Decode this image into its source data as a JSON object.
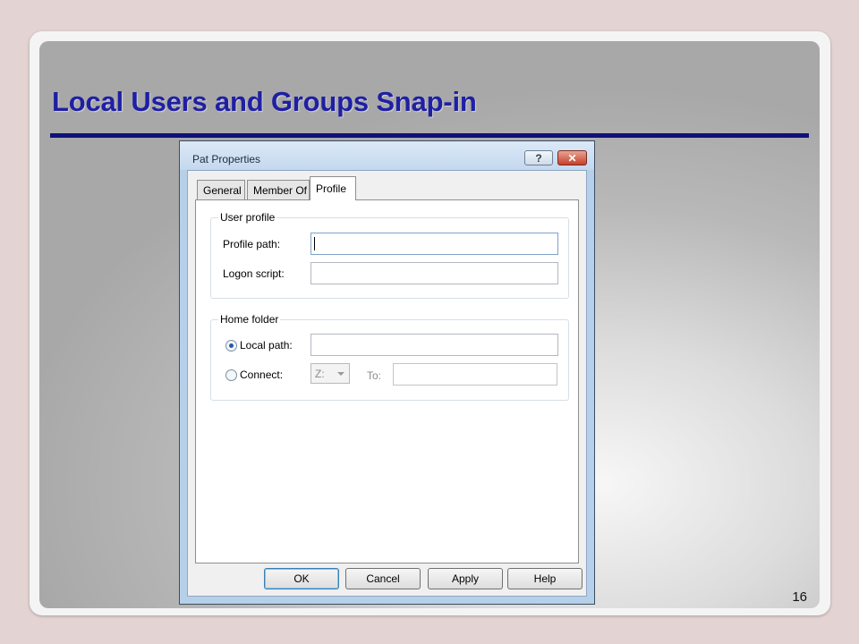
{
  "slide": {
    "title": "Local Users and Groups Snap-in",
    "page_number": "16"
  },
  "dialog": {
    "title": "Pat Properties",
    "help_glyph": "?",
    "close_glyph": "✕",
    "tabs": [
      {
        "label": "General",
        "active": false
      },
      {
        "label": "Member Of",
        "active": false
      },
      {
        "label": "Profile",
        "active": true
      }
    ],
    "user_profile": {
      "legend": "User profile",
      "profile_path_label": "Profile path:",
      "profile_path_value": "",
      "logon_script_label": "Logon script:",
      "logon_script_value": ""
    },
    "home_folder": {
      "legend": "Home folder",
      "local_path_label": "Local path:",
      "local_path_value": "",
      "connect_label": "Connect:",
      "drive_value": "Z:",
      "to_label": "To:",
      "to_value": "",
      "selected": "local_path"
    },
    "buttons": {
      "ok": "OK",
      "cancel": "Cancel",
      "apply": "Apply",
      "help": "Help"
    }
  }
}
